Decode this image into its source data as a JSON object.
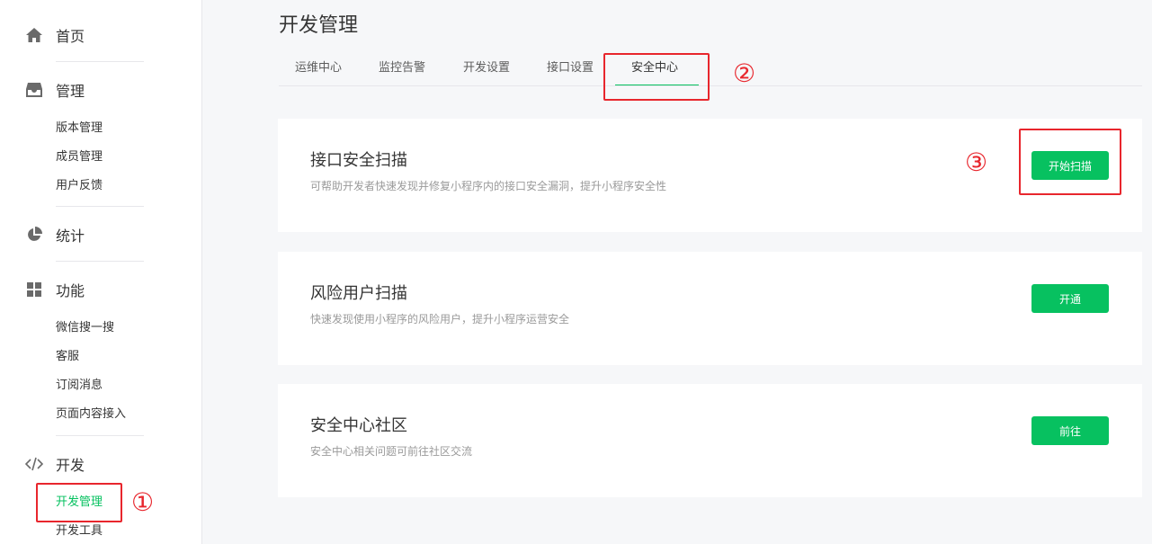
{
  "sidebar": {
    "sections": {
      "home": {
        "icon": "home-icon",
        "label": "首页"
      },
      "manage": {
        "icon": "inbox-icon",
        "label": "管理",
        "items": [
          "版本管理",
          "成员管理",
          "用户反馈"
        ]
      },
      "stats": {
        "icon": "pie-chart-icon",
        "label": "统计"
      },
      "features": {
        "icon": "grid-icon",
        "label": "功能",
        "items": [
          "微信搜一搜",
          "客服",
          "订阅消息",
          "页面内容接入"
        ]
      },
      "develop": {
        "icon": "code-icon",
        "label": "开发",
        "items": [
          "开发管理",
          "开发工具"
        ],
        "active_item": "开发管理"
      }
    }
  },
  "main": {
    "title": "开发管理",
    "tabs": [
      {
        "label": "运维中心"
      },
      {
        "label": "监控告警"
      },
      {
        "label": "开发设置"
      },
      {
        "label": "接口设置"
      },
      {
        "label": "安全中心",
        "active": true
      }
    ],
    "cards": [
      {
        "title": "接口安全扫描",
        "desc": "可帮助开发者快速发现并修复小程序内的接口安全漏洞，提升小程序安全性",
        "button": "开始扫描"
      },
      {
        "title": "风险用户扫描",
        "desc": "快速发现使用小程序的风险用户，提升小程序运营安全",
        "button": "开通"
      },
      {
        "title": "安全中心社区",
        "desc": "安全中心相关问题可前往社区交流",
        "button": "前往"
      }
    ]
  },
  "annotations": {
    "step1": "①",
    "step2": "②",
    "step3": "③",
    "color": "#e8262d"
  },
  "colors": {
    "accent": "#07c160",
    "background": "#f6f7f9",
    "text": "#353535",
    "muted": "#9a9a9a"
  }
}
